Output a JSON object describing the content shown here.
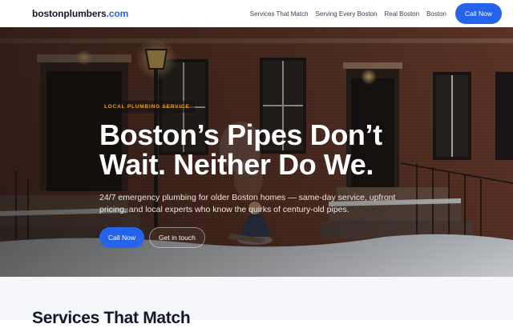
{
  "header": {
    "logo_main": "bostonplumbers",
    "logo_tld": ".com",
    "nav": [
      {
        "label": "Services That Match"
      },
      {
        "label": "Serving Every Boston"
      },
      {
        "label": "Real Boston"
      },
      {
        "label": "Boston"
      }
    ],
    "cta_label": "Call Now"
  },
  "hero": {
    "eyebrow": "LOCAL PLUMBING SERVICE",
    "headline_line1": "Boston’s Pipes Don’t",
    "headline_line2": "Wait. Neither Do We.",
    "subtext": "24/7 emergency plumbing for older Boston homes — same-day service, upfront pricing, and local experts who know the quirks of century-old pipes.",
    "primary_cta": "Call Now",
    "secondary_cta": "Get in touch"
  },
  "section": {
    "title": "Services That Match"
  },
  "colors": {
    "accent": "#2563eb",
    "eyebrow": "#f59e0b",
    "brick": "#7a4030",
    "section_bg": "#f5f7fb"
  },
  "icons": {
    "background": "snowy-brownstone-street-photo"
  }
}
